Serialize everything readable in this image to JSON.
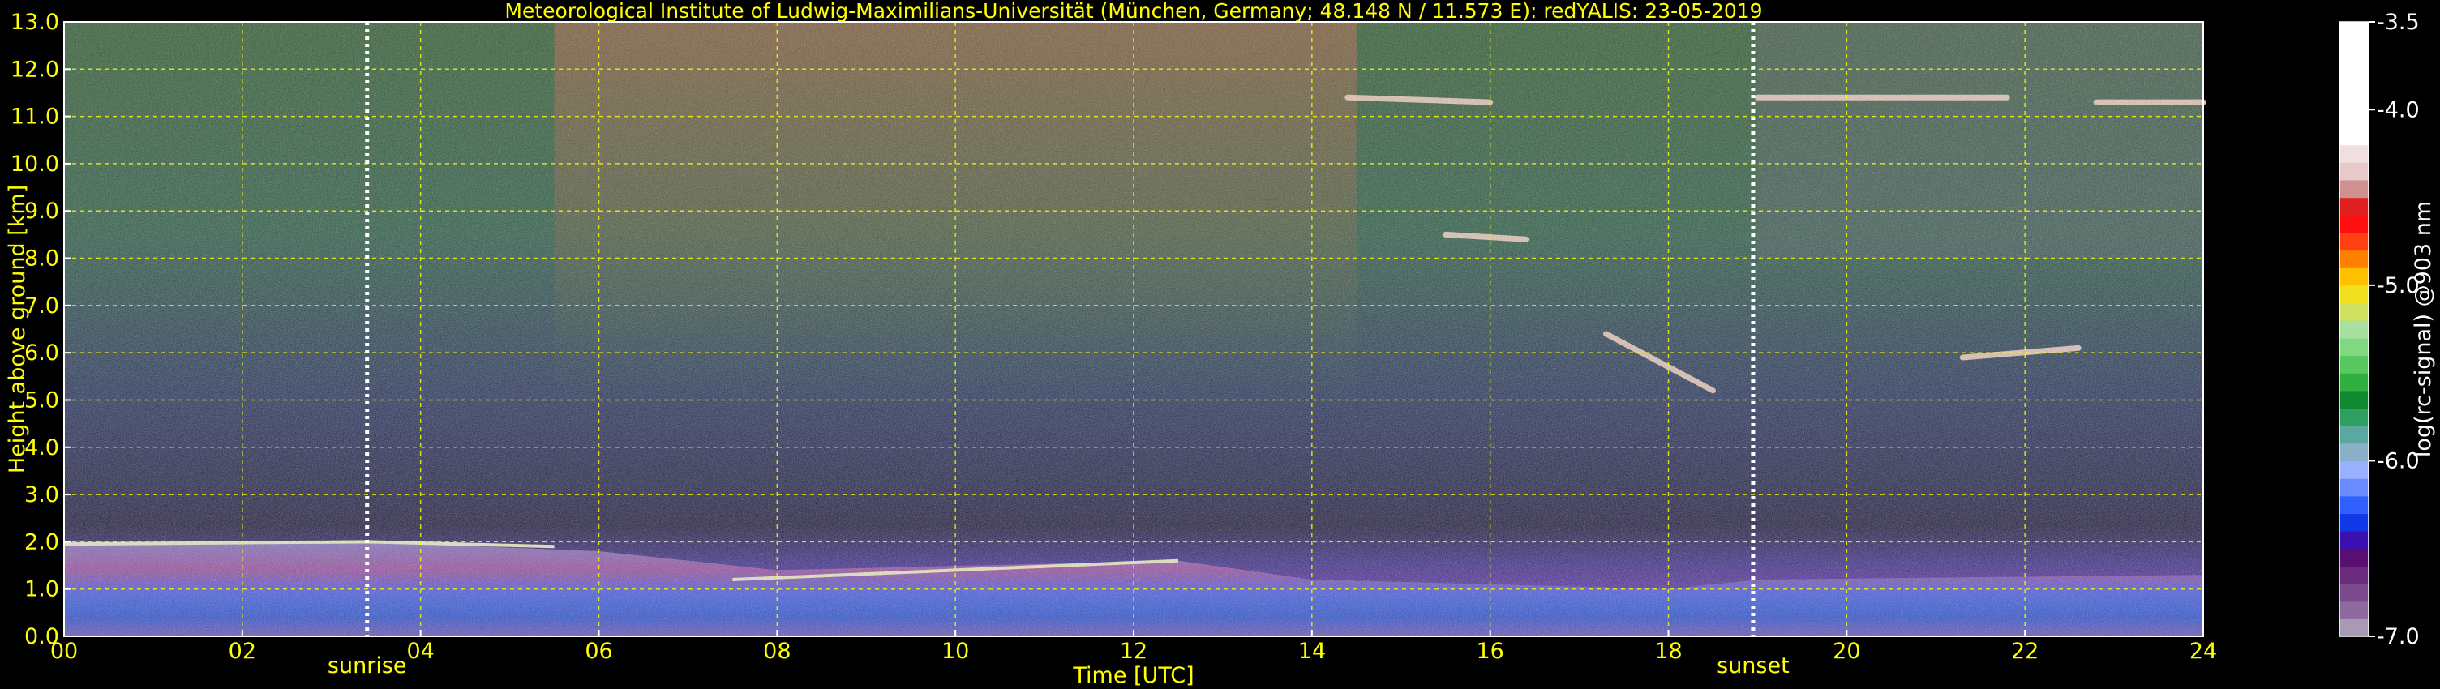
{
  "chart_data": {
    "type": "heatmap",
    "title": "Meteorological Institute of Ludwig-Maximilians-Universität (München, Germany; 48.148 N / 11.573 E):    redYALIS: 23-05-2019",
    "xlabel": "Time [UTC]",
    "ylabel": "Height above ground [km]",
    "xlim": [
      0,
      24
    ],
    "ylim": [
      0,
      13
    ],
    "x_ticks": [
      "00",
      "02",
      "04",
      "06",
      "08",
      "10",
      "12",
      "14",
      "16",
      "18",
      "20",
      "22",
      "24"
    ],
    "x_tick_values": [
      0,
      2,
      4,
      6,
      8,
      10,
      12,
      14,
      16,
      18,
      20,
      22,
      24
    ],
    "y_ticks": [
      "0.0",
      "1.0",
      "2.0",
      "3.0",
      "4.0",
      "5.0",
      "6.0",
      "7.0",
      "8.0",
      "9.0",
      "10.0",
      "11.0",
      "12.0",
      "13.0"
    ],
    "y_tick_values": [
      0,
      1,
      2,
      3,
      4,
      5,
      6,
      7,
      8,
      9,
      10,
      11,
      12,
      13
    ],
    "grid": true,
    "grid_color": "#ffff00",
    "markers": [
      {
        "label": "sunrise",
        "time": 3.4
      },
      {
        "label": "sunset",
        "time": 18.95
      }
    ],
    "colorbar": {
      "label": "log(rc-signal) @903 nm",
      "range": [
        -7.0,
        -3.5
      ],
      "ticks": [
        "-3.5",
        "-4.0",
        "-5.0",
        "-6.0",
        "-7.0"
      ],
      "tick_values": [
        -3.5,
        -4.0,
        -5.0,
        -6.0,
        -7.0
      ],
      "colors": [
        "#a89ab4",
        "#8e6a9e",
        "#7a4a8c",
        "#6c2a7c",
        "#5a1070",
        "#3a10b0",
        "#1038e8",
        "#3060ff",
        "#6a8cff",
        "#9ab0ff",
        "#8ab0c8",
        "#5aa8a0",
        "#30a060",
        "#108a30",
        "#30b040",
        "#5ac860",
        "#80d880",
        "#a8e0a0",
        "#d0e060",
        "#f0e020",
        "#ffc000",
        "#ff8000",
        "#ff4010",
        "#ff1010",
        "#e02020",
        "#d09090",
        "#e8c8c8",
        "#f0e0e0",
        "#ffffff",
        "#ffffff",
        "#ffffff",
        "#ffffff",
        "#ffffff",
        "#ffffff",
        "#ffffff"
      ]
    }
  }
}
